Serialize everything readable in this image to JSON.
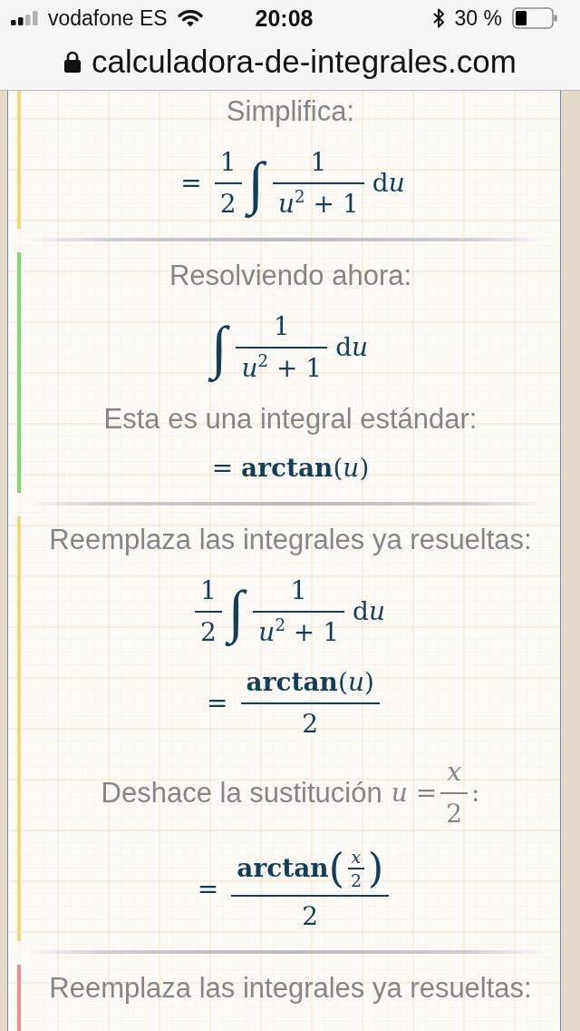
{
  "status_bar": {
    "carrier": "vodafone ES",
    "time": "20:08",
    "battery": "30 %"
  },
  "address_bar": {
    "url": "calculadora-de-integrales.com"
  },
  "steps": [
    {
      "color": "#f7d774",
      "items": [
        {
          "kind": "label",
          "text": "Simplifica:"
        },
        {
          "kind": "math",
          "tokens": [
            {
              "kind": "op",
              "text": "="
            },
            {
              "kind": "frac",
              "num": [
                {
                  "kind": "text",
                  "text": "1"
                }
              ],
              "den": [
                {
                  "kind": "text",
                  "text": "2"
                }
              ]
            },
            {
              "kind": "integral",
              "text": "∫"
            },
            {
              "kind": "frac",
              "num": [
                {
                  "kind": "text",
                  "text": "1"
                }
              ],
              "den": [
                {
                  "kind": "text",
                  "text": "*u*$^{2}$ + 1"
                }
              ]
            },
            {
              "kind": "differential",
              "d": "d",
              "var": "u"
            }
          ]
        }
      ]
    },
    {
      "color": "#80d870",
      "items": [
        {
          "kind": "label",
          "text": "Resolviendo ahora:"
        },
        {
          "kind": "math",
          "tokens": [
            {
              "kind": "integral",
              "text": "∫"
            },
            {
              "kind": "frac",
              "num": [
                {
                  "kind": "text",
                  "text": "1"
                }
              ],
              "den": [
                {
                  "kind": "text",
                  "text": "*u*$^{2}$ + 1"
                }
              ]
            },
            {
              "kind": "differential",
              "d": "d",
              "var": "u"
            }
          ]
        },
        {
          "kind": "label",
          "text": "Esta es una integral estándar:"
        },
        {
          "kind": "math",
          "tokens": [
            {
              "kind": "text",
              "text": "= **arctan**(*u*)"
            }
          ]
        }
      ]
    },
    {
      "color": "#f7d774",
      "items": [
        {
          "kind": "label",
          "text": "Reemplaza las integrales ya resueltas:"
        },
        {
          "kind": "math",
          "tokens": [
            {
              "kind": "frac",
              "num": [
                {
                  "kind": "text",
                  "text": "1"
                }
              ],
              "den": [
                {
                  "kind": "text",
                  "text": "2"
                }
              ]
            },
            {
              "kind": "integral",
              "text": "∫"
            },
            {
              "kind": "frac",
              "num": [
                {
                  "kind": "text",
                  "text": "1"
                }
              ],
              "den": [
                {
                  "kind": "text",
                  "text": "*u*$^{2}$ + 1"
                }
              ]
            },
            {
              "kind": "differential",
              "d": "d",
              "var": "u"
            }
          ]
        },
        {
          "kind": "math",
          "tokens": [
            {
              "kind": "op",
              "text": "="
            },
            {
              "kind": "frac",
              "num": [
                {
                  "kind": "text",
                  "text": "**arctan**(*u*)"
                }
              ],
              "den": [
                {
                  "kind": "text",
                  "text": "2"
                }
              ]
            }
          ]
        },
        {
          "kind": "label",
          "text": "Deshace la sustitución",
          "math": [
            {
              "kind": "text",
              "text": "*u* ="
            },
            {
              "kind": "frac",
              "num": [
                {
                  "kind": "text",
                  "text": "*x*"
                }
              ],
              "den": [
                {
                  "kind": "text",
                  "text": "2"
                }
              ]
            },
            {
              "kind": "text",
              "text": ":"
            }
          ]
        },
        {
          "kind": "math",
          "tokens": [
            {
              "kind": "op",
              "text": "="
            },
            {
              "kind": "frac",
              "num": [
                {
                  "kind": "text",
                  "text": "**arctan**"
                },
                {
                  "kind": "paren",
                  "text": "("
                },
                {
                  "kind": "frac",
                  "num": [
                    {
                      "kind": "text",
                      "text": "*x*"
                    }
                  ],
                  "den": [
                    {
                      "kind": "text",
                      "text": "2"
                    }
                  ]
                },
                {
                  "kind": "paren",
                  "text": ")"
                }
              ],
              "den": [
                {
                  "kind": "text",
                  "text": "2"
                }
              ]
            }
          ]
        }
      ]
    },
    {
      "color": "#f28b8b",
      "items": [
        {
          "kind": "label",
          "text": "Reemplaza las integrales ya resueltas:"
        }
      ]
    }
  ]
}
